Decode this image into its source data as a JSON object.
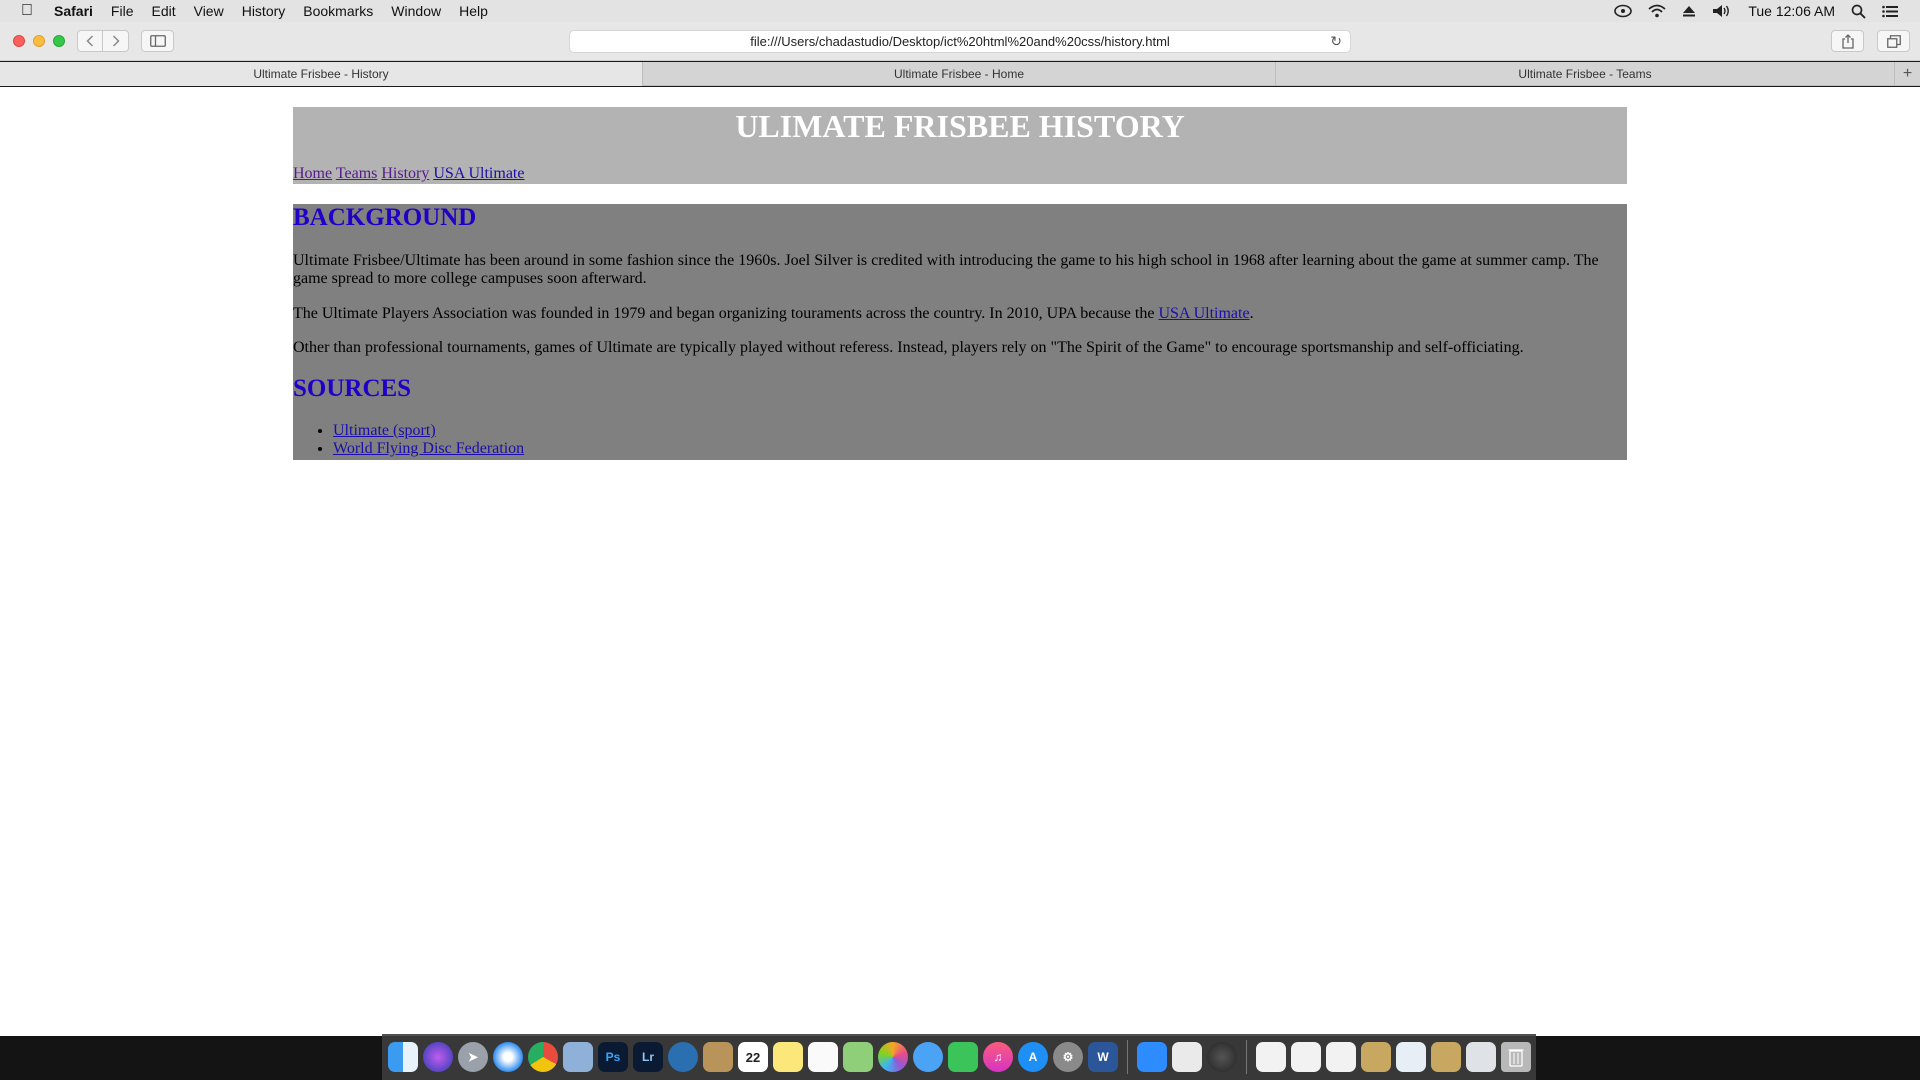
{
  "menubar": {
    "app_name": "Safari",
    "items": [
      "File",
      "Edit",
      "View",
      "History",
      "Bookmarks",
      "Window",
      "Help"
    ],
    "clock": "Tue 12:06 AM"
  },
  "toolbar": {
    "url": "file:///Users/chadastudio/Desktop/ict%20html%20and%20css/history.html"
  },
  "tabs": [
    {
      "title": "Ultimate Frisbee - History",
      "active": true
    },
    {
      "title": "Ultimate Frisbee - Home",
      "active": false
    },
    {
      "title": "Ultimate Frisbee - Teams",
      "active": false
    }
  ],
  "page": {
    "title": "ULIMATE FRISBEE HISTORY",
    "nav": [
      "Home",
      "Teams",
      "History",
      "USA Ultimate"
    ],
    "background_heading": "BACKGROUND",
    "paragraph1": "Ultimate Frisbee/Ultimate has been around in some fashion since the 1960s. Joel Silver is credited with introducing the game to his high school in 1968 after learning about the game at summer camp. The game spread to more college campuses soon afterward.",
    "paragraph2_before": "The Ultimate Players Association was founded in 1979 and began organizing touraments across the country. In 2010, UPA because the ",
    "paragraph2_link": "USA Ultimate",
    "paragraph2_after": ".",
    "paragraph3": "Other than professional tournaments, games of Ultimate are typically played without referess. Instead, players rely on \"The Spirit of the Game\" to encourage sportsmanship and self-officiating.",
    "sources_heading": "SOURCES",
    "sources": [
      "Ultimate (sport)",
      "World Flying Disc Federation"
    ]
  },
  "colors": {
    "header_bg": "#b3b3b3",
    "content_bg": "#808080",
    "heading": "#2000c8",
    "link": "#1a0dab",
    "visited": "#551a8b"
  },
  "dock": {
    "calendar_day": "22",
    "apps": [
      "finder",
      "siri",
      "launchpad",
      "safari",
      "chrome",
      "preview",
      "photoshop",
      "lightroom",
      "screenshot",
      "notebook",
      "calendar",
      "notes",
      "reminders",
      "maps",
      "photos",
      "messages",
      "facetime",
      "itunes",
      "app-store",
      "system-preferences",
      "word",
      "zoom",
      "textedit",
      "quicktime",
      "file",
      "file",
      "file",
      "image",
      "image",
      "image",
      "image",
      "trash"
    ]
  }
}
